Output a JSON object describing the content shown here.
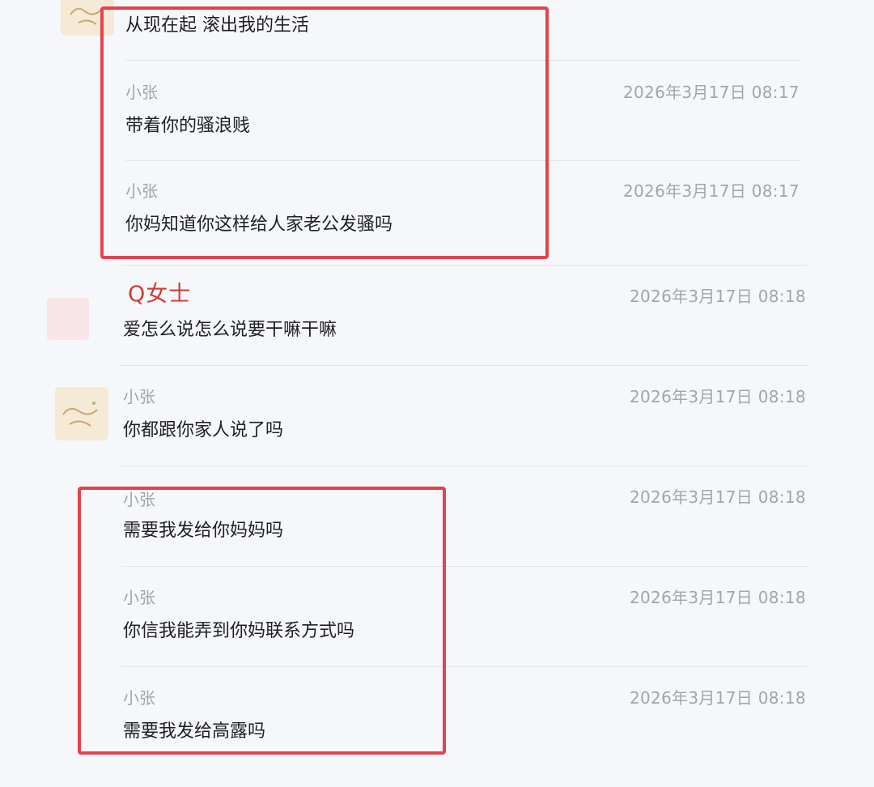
{
  "messages": [
    {
      "sender": "",
      "text": "从现在起 滚出我的生活",
      "time": ""
    },
    {
      "sender": "小张",
      "text": "带着你的骚浪贱",
      "time": "2026年3月17日 08:17"
    },
    {
      "sender": "小张",
      "text": "你妈知道你这样给人家老公发骚吗",
      "time": "2026年3月17日 08:17"
    },
    {
      "sender": "Q女士",
      "text": "爱怎么说怎么说要干嘛干嘛",
      "time": "2026年3月17日 08:18"
    },
    {
      "sender": "小张",
      "text": "你都跟你家人说了吗",
      "time": "2026年3月17日 08:18"
    },
    {
      "sender": "小张",
      "text": "需要我发给你妈妈吗",
      "time": "2026年3月17日 08:18"
    },
    {
      "sender": "小张",
      "text": "你信我能弄到你妈联系方式吗",
      "time": "2026年3月17日 08:18"
    },
    {
      "sender": "小张",
      "text": "需要我发给高露吗",
      "time": "2026年3月17日 08:18"
    }
  ],
  "colors": {
    "highlight_box": "#e3434d",
    "q_name": "#d03b33",
    "background": "#f6f7fa"
  },
  "icons": {
    "avatar_xiaozhang": "sketch-avatar-icon",
    "avatar_q": "pink-avatar-icon"
  }
}
